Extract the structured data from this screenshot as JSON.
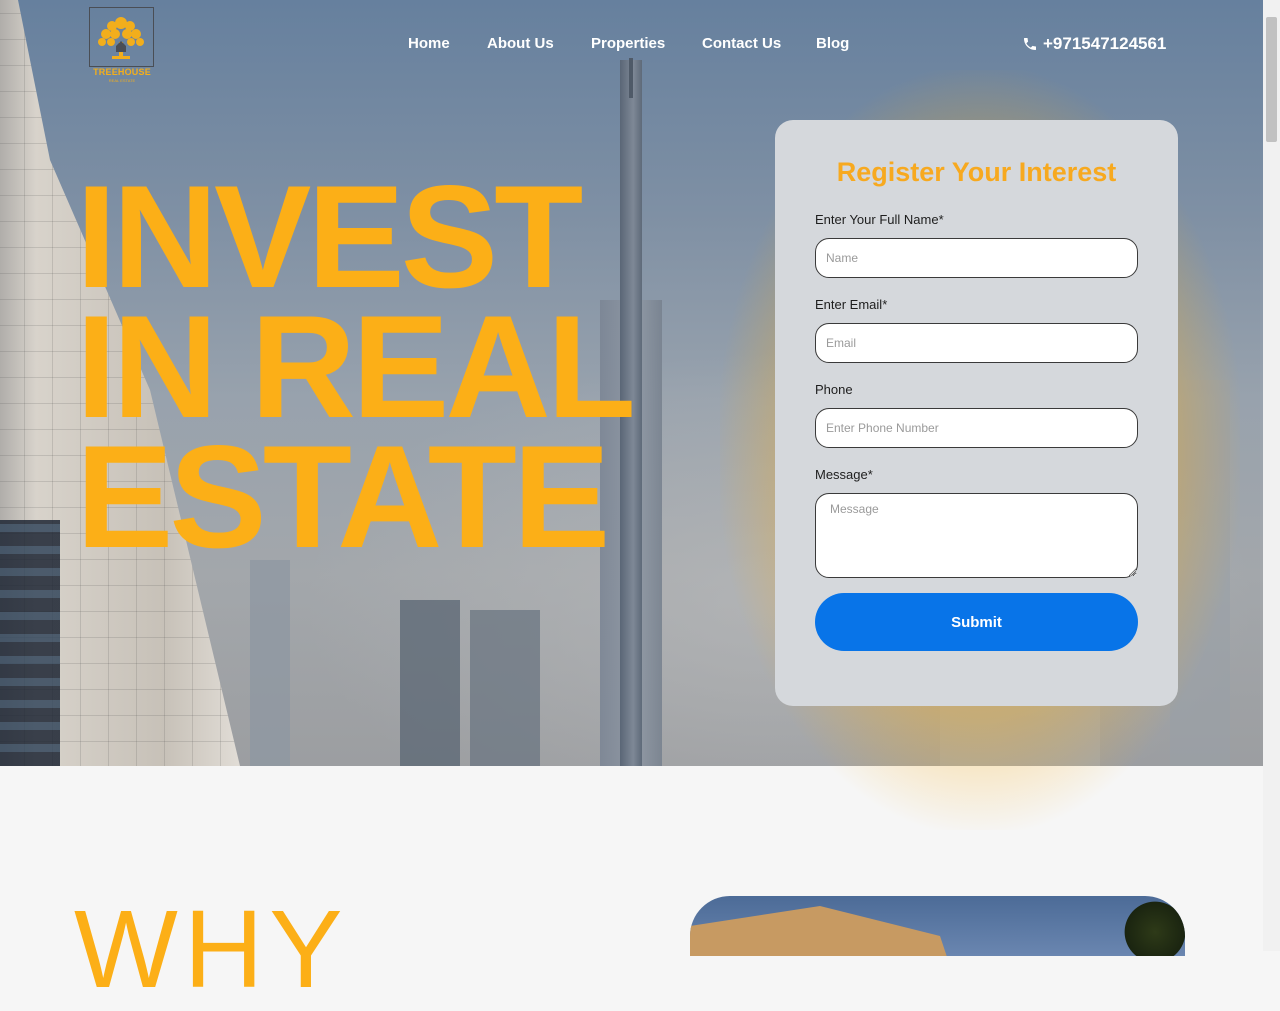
{
  "header": {
    "logo_text": "TREEHOUSE",
    "logo_subtext": "REAL ESTATE",
    "nav": [
      "Home",
      "About Us",
      "Properties",
      "Contact Us",
      "Blog"
    ],
    "phone": "+971547124561"
  },
  "hero": {
    "headline_lines": [
      "INVEST",
      "IN REAL",
      "ESTATE"
    ]
  },
  "form": {
    "title": "Register Your Interest",
    "name_label": "Enter Your Full Name*",
    "name_placeholder": "Name",
    "email_label": "Enter Email*",
    "email_placeholder": "Email",
    "phone_label": "Phone",
    "phone_placeholder": "Enter Phone Number",
    "message_label": "Message*",
    "message_placeholder": "Message",
    "submit_label": "Submit"
  },
  "section2": {
    "heading": "WHY"
  },
  "colors": {
    "accent": "#fcaf17",
    "button": "#0874e8"
  }
}
